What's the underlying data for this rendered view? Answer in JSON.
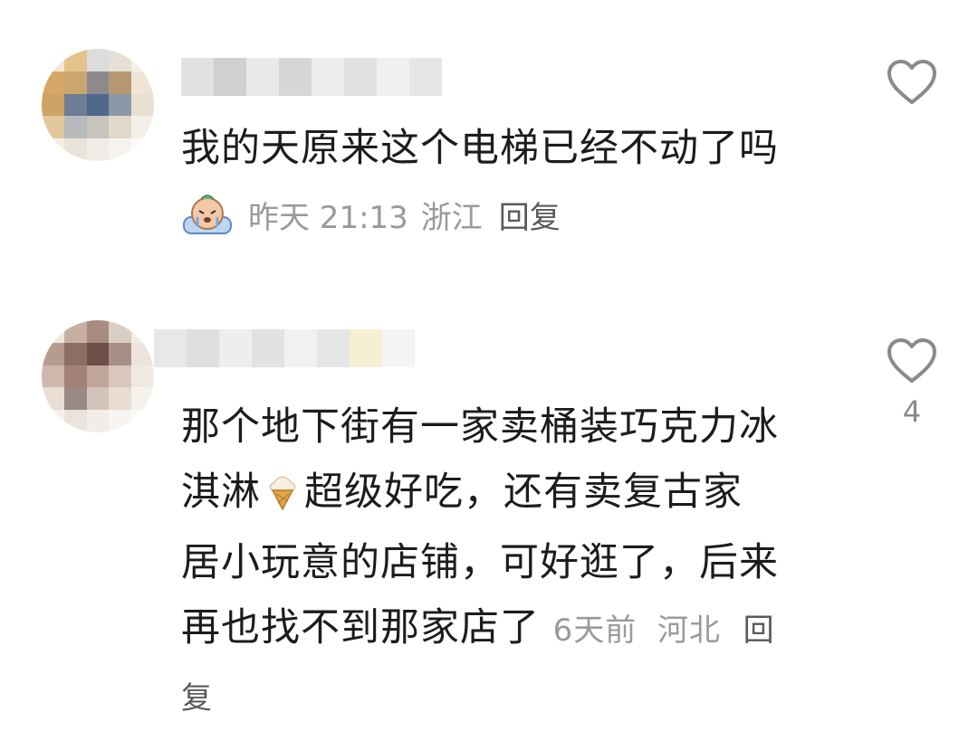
{
  "comments": [
    {
      "text": "我的天原来这个电梯已经不动了吗",
      "time": "昨天 21:13",
      "location": "浙江",
      "reply_label": "回复",
      "likes": ""
    },
    {
      "text_line1": "那个地下街有一家卖桶装巧克力冰",
      "text_line2a": "淇淋",
      "text_line2b": "超级好吃，还有卖复古家",
      "text_line3": "居小玩意的店铺，可好逛了，后来",
      "text_line4": "再也找不到那家店了",
      "time": "6天前",
      "location": "河北",
      "reply_label_part1": "回",
      "reply_label_part2": "复",
      "likes": "4"
    }
  ],
  "icons": {
    "badge": "crying-face-sticker-icon",
    "emoji": "ice-cream-cone-icon",
    "like": "heart-outline-icon"
  },
  "colors": {
    "text": "#1c1c1c",
    "meta": "#9a9a9a",
    "reply": "#5a5a5a",
    "heart": "#8a8a8a"
  }
}
